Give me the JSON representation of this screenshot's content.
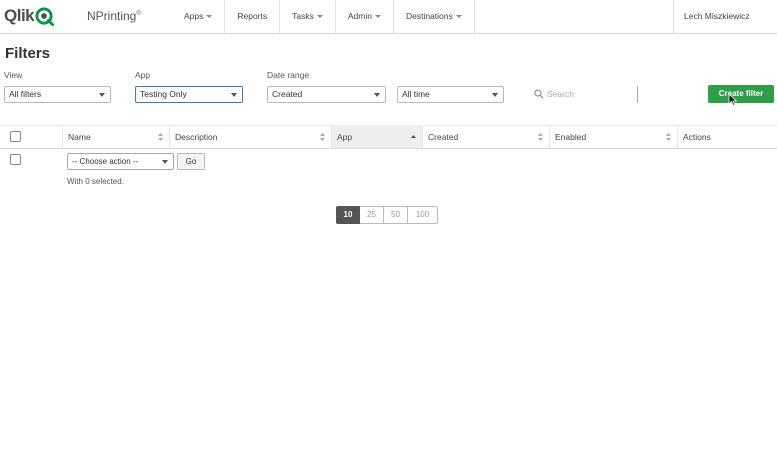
{
  "header": {
    "logo": "Qlik",
    "product": "NPrinting",
    "product_mark": "®",
    "nav": [
      "Apps",
      "Reports",
      "Tasks",
      "Admin",
      "Destinations"
    ],
    "user": "Lech Miszkiewicz"
  },
  "page": {
    "title": "Filters"
  },
  "filters": {
    "view": {
      "label": "View",
      "value": "All filters"
    },
    "app": {
      "label": "App",
      "value": "Testing Only"
    },
    "date_range": {
      "label": "Date range",
      "value": "Created"
    },
    "time": {
      "value": "All time"
    },
    "search_placeholder": "Search",
    "create_label": "Create filter"
  },
  "table": {
    "columns": [
      "Name",
      "Description",
      "App",
      "Created",
      "Enabled",
      "Actions"
    ],
    "sorted_column": "App"
  },
  "bulk": {
    "action_placeholder": "-- Choose action --",
    "go_label": "Go",
    "selected_text": "With 0 selected."
  },
  "pagination": {
    "sizes": [
      "10",
      "25",
      "50",
      "100"
    ],
    "active": "10"
  },
  "colors": {
    "accent": "#2e9e48",
    "qlik_green": "#009845"
  }
}
